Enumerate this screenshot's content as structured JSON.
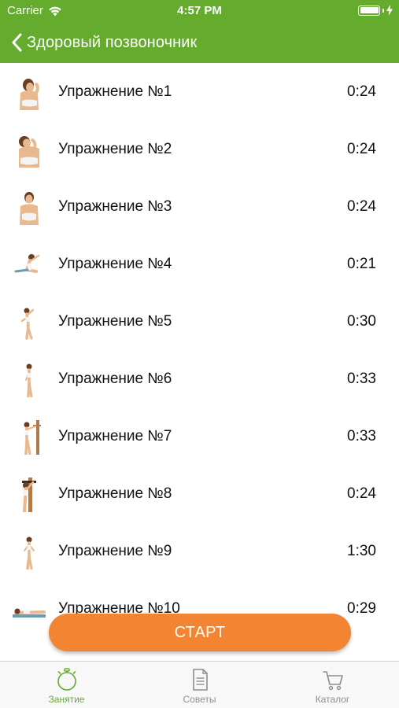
{
  "status_bar": {
    "carrier": "Carrier",
    "time": "4:57 PM",
    "battery_level": 1.0
  },
  "nav": {
    "title": "Здоровый позвоночник"
  },
  "exercises": [
    {
      "label": "Упражнение №1",
      "duration": "0:24",
      "pose": "neck-stretch"
    },
    {
      "label": "Упражнение №2",
      "duration": "0:24",
      "pose": "neck-tilt"
    },
    {
      "label": "Упражнение №3",
      "duration": "0:24",
      "pose": "standing-front"
    },
    {
      "label": "Упражнение №4",
      "duration": "0:21",
      "pose": "seated-stretch"
    },
    {
      "label": "Упражнение №5",
      "duration": "0:30",
      "pose": "side-bend"
    },
    {
      "label": "Упражнение №6",
      "duration": "0:33",
      "pose": "standing-side"
    },
    {
      "label": "Упражнение №7",
      "duration": "0:33",
      "pose": "wall-bar"
    },
    {
      "label": "Упражнение №8",
      "duration": "0:24",
      "pose": "wall-bar-stretch"
    },
    {
      "label": "Упражнение №9",
      "duration": "1:30",
      "pose": "standing-arms"
    },
    {
      "label": "Упражнение №10",
      "duration": "0:29",
      "pose": "lying"
    }
  ],
  "start_button": {
    "label": "СТАРТ"
  },
  "tabs": [
    {
      "label": "Занятие",
      "icon": "stopwatch-icon",
      "active": true
    },
    {
      "label": "Советы",
      "icon": "document-icon",
      "active": false
    },
    {
      "label": "Каталог",
      "icon": "cart-icon",
      "active": false
    }
  ],
  "colors": {
    "header": "#64ab2e",
    "accent": "#f28432",
    "tab_active": "#64ab2e",
    "tab_inactive": "#8e8e8e"
  }
}
